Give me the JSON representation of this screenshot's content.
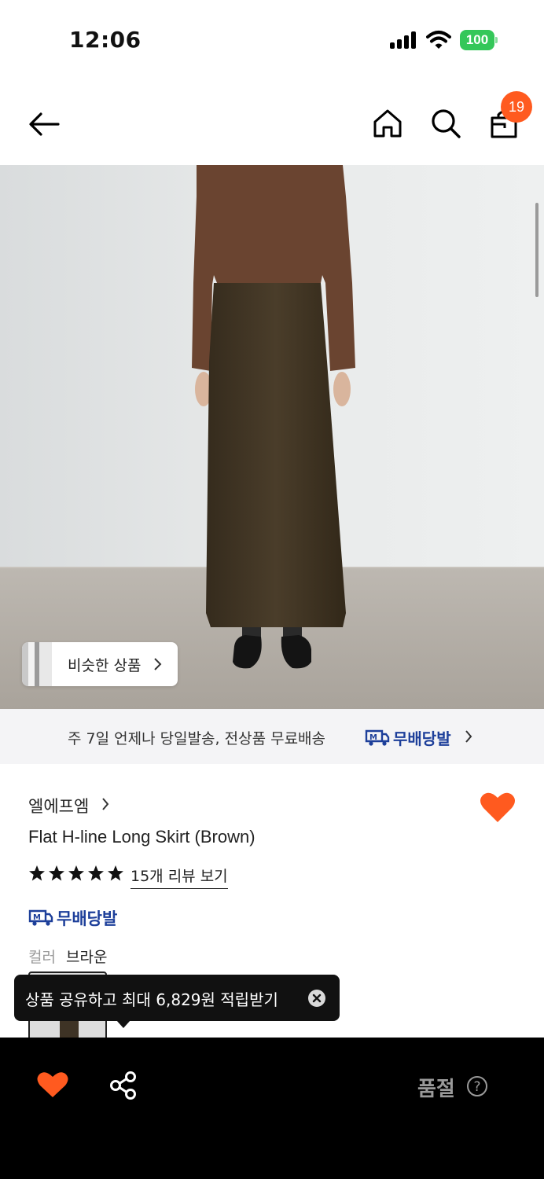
{
  "status_bar": {
    "time": "12:06",
    "battery": "100",
    "icons": [
      "signal-icon",
      "wifi-icon",
      "battery-icon"
    ]
  },
  "header": {
    "icons": [
      "back-arrow-icon",
      "home-icon",
      "search-icon",
      "shopping-bag-icon"
    ],
    "cart_count": "19"
  },
  "hero": {
    "similar_products_label": "비슷한 상품"
  },
  "delivery_banner": {
    "text": "주 7일 언제나 당일발송, 전상품 무료배송",
    "badge_label": "무배당발"
  },
  "product": {
    "brand": "엘에프엠",
    "title": "Flat H-line Long Skirt (Brown)",
    "rating_stars": 5,
    "review_link": "15개 리뷰 보기",
    "delivery_badge": "무배당발",
    "color_label": "컬러",
    "color_value": "브라운",
    "wishlisted": true
  },
  "share_tooltip": {
    "text": "상품 공유하고 최대 6,829원 적립받기"
  },
  "bottom_bar": {
    "status_label": "품절",
    "icons": [
      "heart-icon",
      "share-icon",
      "help-circle-icon"
    ]
  },
  "colors": {
    "accent": "#FF5A1F",
    "badge_blue": "#1D3F9A",
    "battery_green": "#34C759",
    "bottom_bar_bg": "#000000",
    "soldout_text": "#9A9A9A"
  }
}
